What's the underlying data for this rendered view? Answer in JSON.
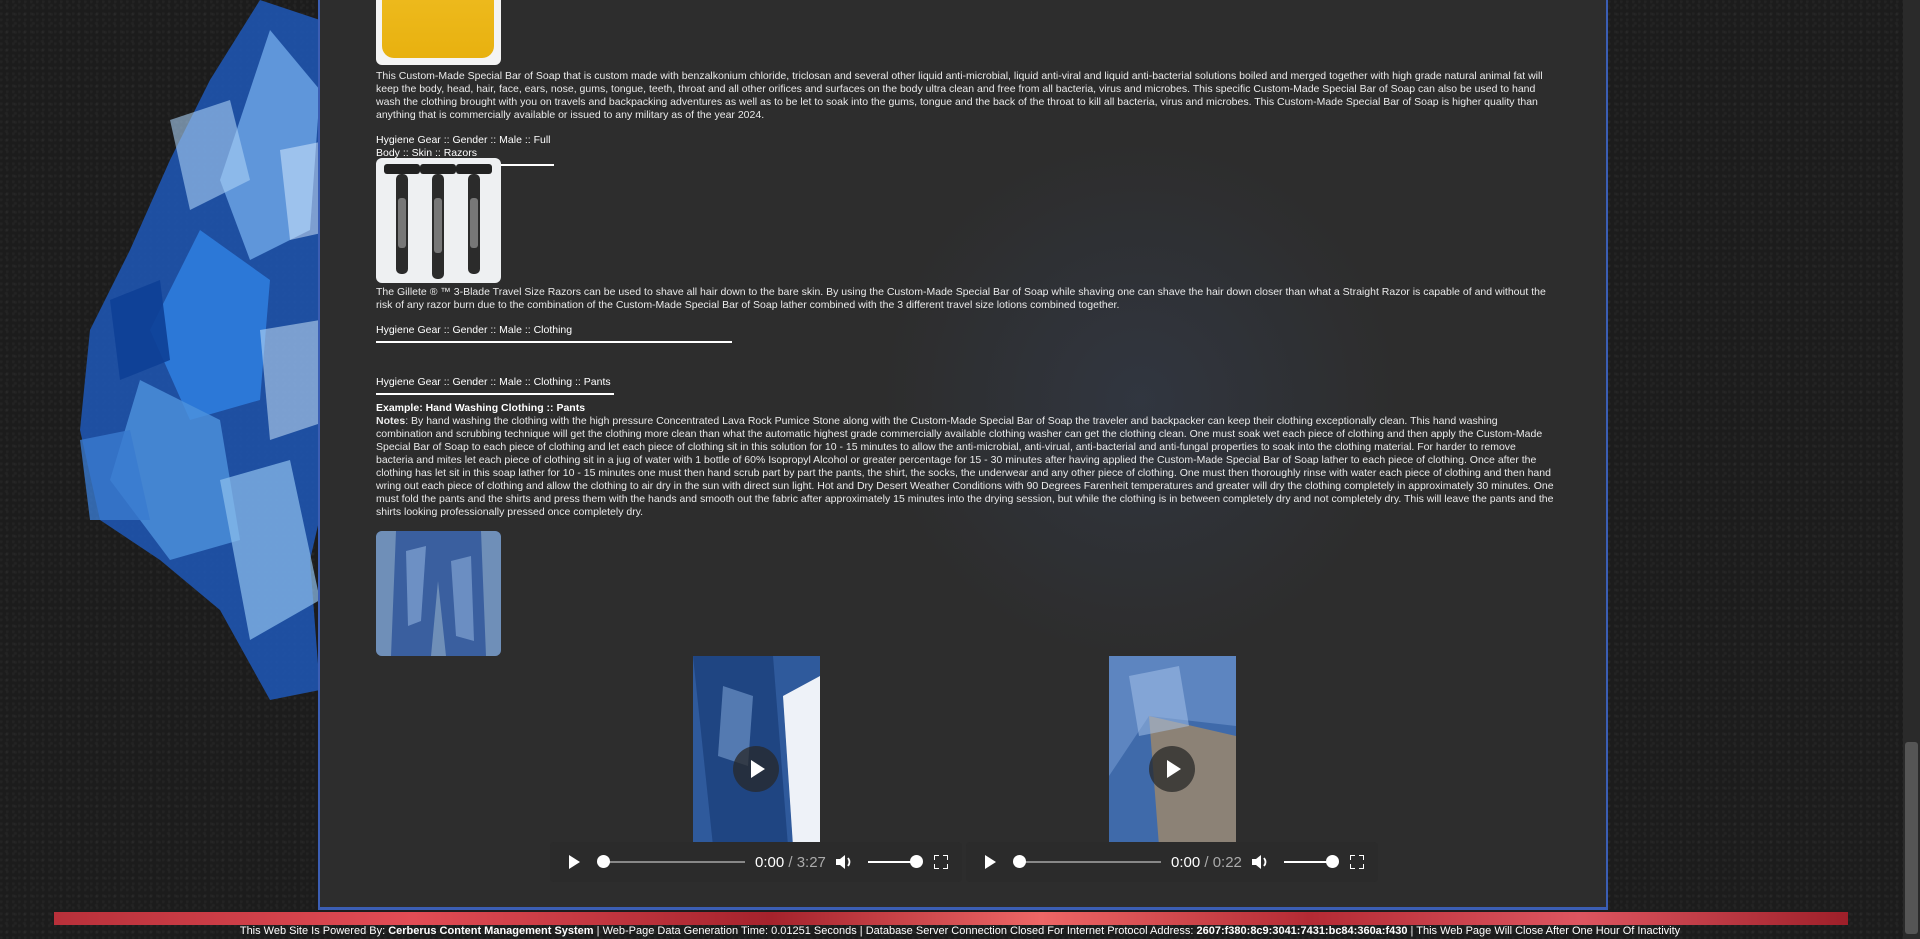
{
  "items": [
    {
      "description": "This Custom-Made Special Bar of Soap that is custom made with benzalkonium chloride, triclosan and several other liquid anti-microbial, liquid anti-viral and liquid anti-bacterial solutions boiled and merged together with high grade natural animal fat will keep the body, head, hair, face, ears, nose, gums, tongue, teeth, throat and all other orifices and surfaces on the body ultra clean and free from all bacteria, virus and microbes. This specific Custom-Made Special Bar of Soap can also be used to hand wash the clothing brought with you on travels and backpacking adventures as well as to be let to soak into the gums, tongue and the back of the throat to kill all bacteria, virus and microbes. This Custom-Made Special Bar of Soap is higher quality than anything that is commercially available or issued to any military as of the year 2024."
    }
  ],
  "razors": {
    "heading": "Hygiene Gear :: Gender :: Male :: Full Body :: Skin :: Razors",
    "description": "The Gillete ® ™ 3-Blade Travel Size Razors can be used to shave all hair down to the bare skin. By using the Custom-Made Special Bar of Soap while shaving one can shave the hair down closer than what a Straight Razor is capable of and without the risk of any razor burn due to the combination of the Custom-Made Special Bar of Soap lather combined with the 3 different travel size lotions combined together."
  },
  "clothing": {
    "heading": "Hygiene Gear :: Gender :: Male :: Clothing"
  },
  "pants": {
    "heading": "Hygiene Gear :: Gender :: Male :: Clothing :: Pants",
    "example_title": "Example: Hand Washing Clothing :: Pants",
    "notes_label": "Notes",
    "notes_text": ": By hand washing the clothing with the high pressure Concentrated Lava Rock Pumice Stone along with the Custom-Made Special Bar of Soap the traveler and backpacker can keep their clothing exceptionally clean. This hand washing combination and scrubbing technique will get the clothing more clean than what the automatic highest grade commercially available clothing washer can get the clothing clean. One must soak wet each piece of clothing and then apply the Custom-Made Special Bar of Soap to each piece of clothing and let each piece of clothing sit in this solution for 10 - 15 minutes to allow the anti-microbial, anti-virual, anti-bacterial and anti-fungal properties to soak into the clothing material. For harder to remove bacteria and mites let each piece of clothing sit in a jug of water with 1 bottle of 60% Isopropyl Alcohol or greater percentage for 15 - 30 minutes after having applied the Custom-Made Special Bar of Soap lather to each piece of clothing. Once after the clothing has let sit in this soap lather for 10 - 15 minutes one must then hand scrub part by part the pants, the shirt, the socks, the underwear and any other piece of clothing. One must then thoroughly rinse with water each piece of clothing and then hand wring out each piece of clothing and allow the clothing to air dry in the sun with direct sun light. Hot and Dry Desert Weather Conditions with 90 Degrees Farenheit temperatures and greater will dry the clothing completely in approximately 30 minutes. One must fold the pants and the shirts and press them with the hands and smooth out the fabric after approximately 15 minutes into the drying session, but while the clothing is in between completely dry and not completely dry. This will leave the pants and the shirts looking professionally pressed once completely dry."
  },
  "videos": [
    {
      "current": "0:00",
      "duration": " / 3:27"
    },
    {
      "current": "0:00",
      "duration": " / 0:22"
    }
  ],
  "footer": {
    "powered_prefix": "This Web Site Is Powered By: ",
    "powered_name": "Cerberus Content Management System",
    "gen_time": " | Web-Page Data Generation Time: 0.01251 Seconds | Database Server Connection Closed For Internet Protocol Address: ",
    "ip": "2607:f380:8c9:3041:7431:bc84:360a:f430",
    "close_notice": " |  This Web Page Will Close After One Hour Of Inactivity"
  }
}
